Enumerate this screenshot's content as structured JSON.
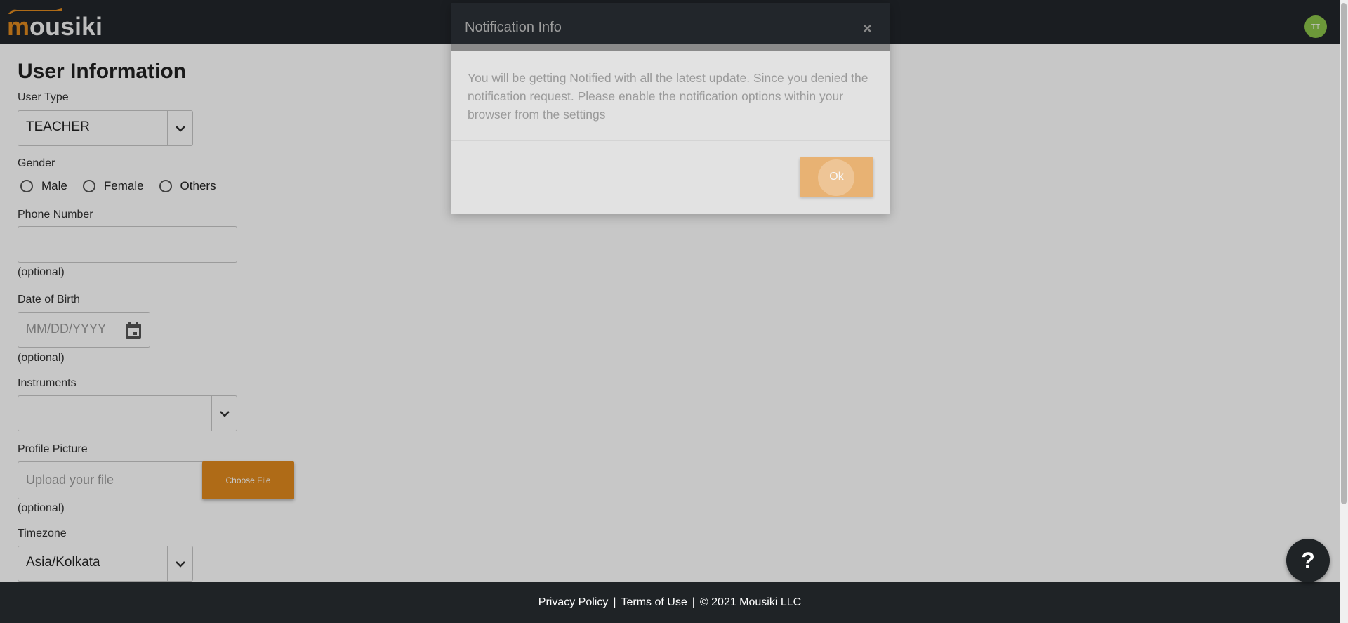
{
  "header": {
    "logo_first": "m",
    "logo_rest": "ousiki",
    "avatar_initials": "TT"
  },
  "form": {
    "title": "User Information",
    "user_type_label": "User Type",
    "user_type_value": "TEACHER",
    "gender_label": "Gender",
    "gender_options": [
      "Male",
      "Female",
      "Others"
    ],
    "phone_label": "Phone Number",
    "phone_value": "",
    "optional": "(optional)",
    "dob_label": "Date of Birth",
    "dob_placeholder": "MM/DD/YYYY",
    "instruments_label": "Instruments",
    "instruments_value": "",
    "profile_label": "Profile Picture",
    "profile_placeholder": "Upload your file",
    "choose_file": "Choose File",
    "timezone_label": "Timezone",
    "timezone_value": "Asia/Kolkata"
  },
  "footer": {
    "privacy": "Privacy Policy",
    "terms": "Terms of Use",
    "copyright": "© 2021 Mousiki LLC",
    "separator": "|"
  },
  "help": {
    "label": "?"
  },
  "modal": {
    "title": "Notification Info",
    "close": "×",
    "body": "You will be getting Notified with all the latest update. Since you denied the notification request. Please enable the notification options within your browser from the settings",
    "ok": "Ok"
  },
  "colors": {
    "accent": "#e08a1e",
    "header_bg": "#22262b",
    "avatar": "#8bc34a"
  }
}
